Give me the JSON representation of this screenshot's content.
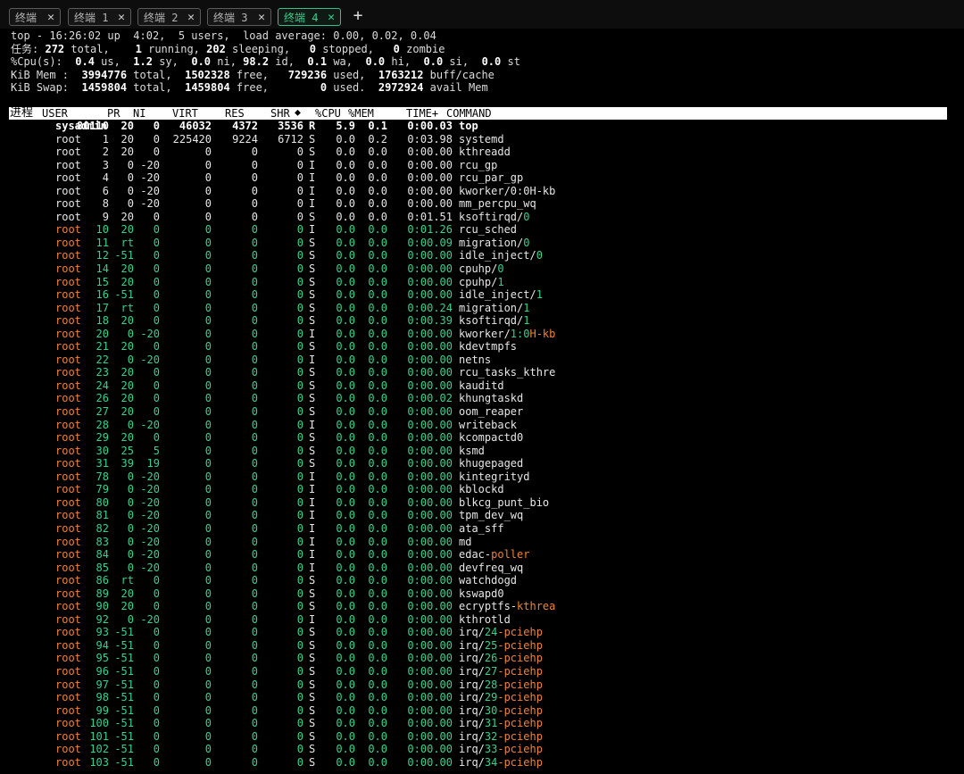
{
  "tabs": [
    {
      "label": "终端",
      "active": false
    },
    {
      "label": "终端 1",
      "active": false
    },
    {
      "label": "终端 2",
      "active": false
    },
    {
      "label": "终端 3",
      "active": false
    },
    {
      "label": "终端 4",
      "active": true
    }
  ],
  "summary": {
    "line1": "top - 16:26:02 up  4:02,  5 users,  load average: 0.00, 0.02, 0.04",
    "tasks": {
      "label": "任务:",
      "total": "272",
      "running": "1",
      "sleeping": "202",
      "stopped": "0",
      "zombie": "0"
    },
    "cpu": {
      "us": "0.4",
      "sy": "1.2",
      "ni": "0.0",
      "id": "98.2",
      "wa": "0.1",
      "hi": "0.0",
      "si": "0.0",
      "st": "0.0"
    },
    "mem": {
      "total": "3994776",
      "free": "1502328",
      "used": "729236",
      "buff": "1763212"
    },
    "swap": {
      "total": "1459804",
      "free": "1459804",
      "used": "0",
      "avail": "2972924"
    }
  },
  "columns": [
    "进程",
    "USER",
    "PR",
    "NI",
    "VIRT",
    "RES",
    "SHR",
    "⬥",
    "%CPU",
    "%MEM",
    "TIME+",
    "COMMAND"
  ],
  "processes": [
    {
      "pid": "80110",
      "user": "sysadmin",
      "pr": "20",
      "ni": "0",
      "virt": "46032",
      "res": "4372",
      "shr": "3536",
      "s": "R",
      "cpu": "5.9",
      "mem": "0.1",
      "time": "0:00.03",
      "cmd": "top",
      "sfx": "",
      "style": "bold"
    },
    {
      "pid": "1",
      "user": "root",
      "pr": "20",
      "ni": "0",
      "virt": "225420",
      "res": "9224",
      "shr": "6712",
      "s": "S",
      "cpu": "0.0",
      "mem": "0.2",
      "time": "0:03.98",
      "cmd": "systemd",
      "sfx": "",
      "style": "w"
    },
    {
      "pid": "2",
      "user": "root",
      "pr": "20",
      "ni": "0",
      "virt": "0",
      "res": "0",
      "shr": "0",
      "s": "S",
      "cpu": "0.0",
      "mem": "0.0",
      "time": "0:00.00",
      "cmd": "kthreadd",
      "sfx": "",
      "style": "w"
    },
    {
      "pid": "3",
      "user": "root",
      "pr": "0",
      "ni": "-20",
      "virt": "0",
      "res": "0",
      "shr": "0",
      "s": "I",
      "cpu": "0.0",
      "mem": "0.0",
      "time": "0:00.00",
      "cmd": "rcu_gp",
      "sfx": "",
      "style": "w"
    },
    {
      "pid": "4",
      "user": "root",
      "pr": "0",
      "ni": "-20",
      "virt": "0",
      "res": "0",
      "shr": "0",
      "s": "I",
      "cpu": "0.0",
      "mem": "0.0",
      "time": "0:00.00",
      "cmd": "rcu_par_gp",
      "sfx": "",
      "style": "w"
    },
    {
      "pid": "6",
      "user": "root",
      "pr": "0",
      "ni": "-20",
      "virt": "0",
      "res": "0",
      "shr": "0",
      "s": "I",
      "cpu": "0.0",
      "mem": "0.0",
      "time": "0:00.00",
      "cmd": "kworker/0:0H-kb",
      "sfx": "",
      "style": "w"
    },
    {
      "pid": "8",
      "user": "root",
      "pr": "0",
      "ni": "-20",
      "virt": "0",
      "res": "0",
      "shr": "0",
      "s": "I",
      "cpu": "0.0",
      "mem": "0.0",
      "time": "0:00.00",
      "cmd": "mm_percpu_wq",
      "sfx": "",
      "style": "w"
    },
    {
      "pid": "9",
      "user": "root",
      "pr": "20",
      "ni": "0",
      "virt": "0",
      "res": "0",
      "shr": "0",
      "s": "S",
      "cpu": "0.0",
      "mem": "0.0",
      "time": "0:01.51",
      "cmd": "ksoftirqd/",
      "sfx": "0",
      "sfxc": "g",
      "style": "w"
    },
    {
      "pid": "10",
      "user": "root",
      "pr": "20",
      "ni": "0",
      "virt": "0",
      "res": "0",
      "shr": "0",
      "s": "I",
      "cpu": "0.0",
      "mem": "0.0",
      "time": "0:01.26",
      "cmd": "rcu_sched",
      "sfx": "",
      "style": "g"
    },
    {
      "pid": "11",
      "user": "root",
      "pr": "rt",
      "ni": "0",
      "virt": "0",
      "res": "0",
      "shr": "0",
      "s": "S",
      "cpu": "0.0",
      "mem": "0.0",
      "time": "0:00.09",
      "cmd": "migration/",
      "sfx": "0",
      "sfxc": "g",
      "style": "g"
    },
    {
      "pid": "12",
      "user": "root",
      "pr": "-51",
      "ni": "0",
      "virt": "0",
      "res": "0",
      "shr": "0",
      "s": "S",
      "cpu": "0.0",
      "mem": "0.0",
      "time": "0:00.00",
      "cmd": "idle_inject/",
      "sfx": "0",
      "sfxc": "g",
      "style": "g"
    },
    {
      "pid": "14",
      "user": "root",
      "pr": "20",
      "ni": "0",
      "virt": "0",
      "res": "0",
      "shr": "0",
      "s": "S",
      "cpu": "0.0",
      "mem": "0.0",
      "time": "0:00.00",
      "cmd": "cpuhp/",
      "sfx": "0",
      "sfxc": "g",
      "style": "g"
    },
    {
      "pid": "15",
      "user": "root",
      "pr": "20",
      "ni": "0",
      "virt": "0",
      "res": "0",
      "shr": "0",
      "s": "S",
      "cpu": "0.0",
      "mem": "0.0",
      "time": "0:00.00",
      "cmd": "cpuhp/",
      "sfx": "1",
      "sfxc": "g",
      "style": "g"
    },
    {
      "pid": "16",
      "user": "root",
      "pr": "-51",
      "ni": "0",
      "virt": "0",
      "res": "0",
      "shr": "0",
      "s": "S",
      "cpu": "0.0",
      "mem": "0.0",
      "time": "0:00.00",
      "cmd": "idle_inject/",
      "sfx": "1",
      "sfxc": "g",
      "style": "g"
    },
    {
      "pid": "17",
      "user": "root",
      "pr": "rt",
      "ni": "0",
      "virt": "0",
      "res": "0",
      "shr": "0",
      "s": "S",
      "cpu": "0.0",
      "mem": "0.0",
      "time": "0:00.24",
      "cmd": "migration/",
      "sfx": "1",
      "sfxc": "g",
      "style": "g"
    },
    {
      "pid": "18",
      "user": "root",
      "pr": "20",
      "ni": "0",
      "virt": "0",
      "res": "0",
      "shr": "0",
      "s": "S",
      "cpu": "0.0",
      "mem": "0.0",
      "time": "0:00.39",
      "cmd": "ksoftirqd/",
      "sfx": "1",
      "sfxc": "g",
      "style": "g"
    },
    {
      "pid": "20",
      "user": "root",
      "pr": "0",
      "ni": "-20",
      "virt": "0",
      "res": "0",
      "shr": "0",
      "s": "I",
      "cpu": "0.0",
      "mem": "0.0",
      "time": "0:00.00",
      "cmd": "kworker/",
      "sfx": "1:0H-kb",
      "sfxc": "mixed",
      "style": "g"
    },
    {
      "pid": "21",
      "user": "root",
      "pr": "20",
      "ni": "0",
      "virt": "0",
      "res": "0",
      "shr": "0",
      "s": "S",
      "cpu": "0.0",
      "mem": "0.0",
      "time": "0:00.00",
      "cmd": "kdevtmpfs",
      "sfx": "",
      "style": "g"
    },
    {
      "pid": "22",
      "user": "root",
      "pr": "0",
      "ni": "-20",
      "virt": "0",
      "res": "0",
      "shr": "0",
      "s": "I",
      "cpu": "0.0",
      "mem": "0.0",
      "time": "0:00.00",
      "cmd": "netns",
      "sfx": "",
      "style": "g"
    },
    {
      "pid": "23",
      "user": "root",
      "pr": "20",
      "ni": "0",
      "virt": "0",
      "res": "0",
      "shr": "0",
      "s": "S",
      "cpu": "0.0",
      "mem": "0.0",
      "time": "0:00.00",
      "cmd": "rcu_tasks_kthre",
      "sfx": "",
      "style": "g"
    },
    {
      "pid": "24",
      "user": "root",
      "pr": "20",
      "ni": "0",
      "virt": "0",
      "res": "0",
      "shr": "0",
      "s": "S",
      "cpu": "0.0",
      "mem": "0.0",
      "time": "0:00.00",
      "cmd": "kauditd",
      "sfx": "",
      "style": "g"
    },
    {
      "pid": "26",
      "user": "root",
      "pr": "20",
      "ni": "0",
      "virt": "0",
      "res": "0",
      "shr": "0",
      "s": "S",
      "cpu": "0.0",
      "mem": "0.0",
      "time": "0:00.02",
      "cmd": "khungtaskd",
      "sfx": "",
      "style": "g"
    },
    {
      "pid": "27",
      "user": "root",
      "pr": "20",
      "ni": "0",
      "virt": "0",
      "res": "0",
      "shr": "0",
      "s": "S",
      "cpu": "0.0",
      "mem": "0.0",
      "time": "0:00.00",
      "cmd": "oom_reaper",
      "sfx": "",
      "style": "g"
    },
    {
      "pid": "28",
      "user": "root",
      "pr": "0",
      "ni": "-20",
      "virt": "0",
      "res": "0",
      "shr": "0",
      "s": "I",
      "cpu": "0.0",
      "mem": "0.0",
      "time": "0:00.00",
      "cmd": "writeback",
      "sfx": "",
      "style": "g"
    },
    {
      "pid": "29",
      "user": "root",
      "pr": "20",
      "ni": "0",
      "virt": "0",
      "res": "0",
      "shr": "0",
      "s": "S",
      "cpu": "0.0",
      "mem": "0.0",
      "time": "0:00.00",
      "cmd": "kcompactd0",
      "sfx": "",
      "style": "g"
    },
    {
      "pid": "30",
      "user": "root",
      "pr": "25",
      "ni": "5",
      "virt": "0",
      "res": "0",
      "shr": "0",
      "s": "S",
      "cpu": "0.0",
      "mem": "0.0",
      "time": "0:00.00",
      "cmd": "ksmd",
      "sfx": "",
      "style": "g"
    },
    {
      "pid": "31",
      "user": "root",
      "pr": "39",
      "ni": "19",
      "virt": "0",
      "res": "0",
      "shr": "0",
      "s": "S",
      "cpu": "0.0",
      "mem": "0.0",
      "time": "0:00.00",
      "cmd": "khugepaged",
      "sfx": "",
      "style": "g"
    },
    {
      "pid": "78",
      "user": "root",
      "pr": "0",
      "ni": "-20",
      "virt": "0",
      "res": "0",
      "shr": "0",
      "s": "I",
      "cpu": "0.0",
      "mem": "0.0",
      "time": "0:00.00",
      "cmd": "kintegrityd",
      "sfx": "",
      "style": "g"
    },
    {
      "pid": "79",
      "user": "root",
      "pr": "0",
      "ni": "-20",
      "virt": "0",
      "res": "0",
      "shr": "0",
      "s": "I",
      "cpu": "0.0",
      "mem": "0.0",
      "time": "0:00.00",
      "cmd": "kblockd",
      "sfx": "",
      "style": "g"
    },
    {
      "pid": "80",
      "user": "root",
      "pr": "0",
      "ni": "-20",
      "virt": "0",
      "res": "0",
      "shr": "0",
      "s": "I",
      "cpu": "0.0",
      "mem": "0.0",
      "time": "0:00.00",
      "cmd": "blkcg_punt_bio",
      "sfx": "",
      "style": "g"
    },
    {
      "pid": "81",
      "user": "root",
      "pr": "0",
      "ni": "-20",
      "virt": "0",
      "res": "0",
      "shr": "0",
      "s": "I",
      "cpu": "0.0",
      "mem": "0.0",
      "time": "0:00.00",
      "cmd": "tpm_dev_wq",
      "sfx": "",
      "style": "g"
    },
    {
      "pid": "82",
      "user": "root",
      "pr": "0",
      "ni": "-20",
      "virt": "0",
      "res": "0",
      "shr": "0",
      "s": "I",
      "cpu": "0.0",
      "mem": "0.0",
      "time": "0:00.00",
      "cmd": "ata_sff",
      "sfx": "",
      "style": "g"
    },
    {
      "pid": "83",
      "user": "root",
      "pr": "0",
      "ni": "-20",
      "virt": "0",
      "res": "0",
      "shr": "0",
      "s": "I",
      "cpu": "0.0",
      "mem": "0.0",
      "time": "0:00.00",
      "cmd": "md",
      "sfx": "",
      "style": "g"
    },
    {
      "pid": "84",
      "user": "root",
      "pr": "0",
      "ni": "-20",
      "virt": "0",
      "res": "0",
      "shr": "0",
      "s": "I",
      "cpu": "0.0",
      "mem": "0.0",
      "time": "0:00.00",
      "cmd": "edac-",
      "sfx": "poller",
      "sfxc": "o",
      "style": "g"
    },
    {
      "pid": "85",
      "user": "root",
      "pr": "0",
      "ni": "-20",
      "virt": "0",
      "res": "0",
      "shr": "0",
      "s": "I",
      "cpu": "0.0",
      "mem": "0.0",
      "time": "0:00.00",
      "cmd": "devfreq_wq",
      "sfx": "",
      "style": "g"
    },
    {
      "pid": "86",
      "user": "root",
      "pr": "rt",
      "ni": "0",
      "virt": "0",
      "res": "0",
      "shr": "0",
      "s": "S",
      "cpu": "0.0",
      "mem": "0.0",
      "time": "0:00.00",
      "cmd": "watchdogd",
      "sfx": "",
      "style": "g"
    },
    {
      "pid": "89",
      "user": "root",
      "pr": "20",
      "ni": "0",
      "virt": "0",
      "res": "0",
      "shr": "0",
      "s": "S",
      "cpu": "0.0",
      "mem": "0.0",
      "time": "0:00.00",
      "cmd": "kswapd0",
      "sfx": "",
      "style": "g"
    },
    {
      "pid": "90",
      "user": "root",
      "pr": "20",
      "ni": "0",
      "virt": "0",
      "res": "0",
      "shr": "0",
      "s": "S",
      "cpu": "0.0",
      "mem": "0.0",
      "time": "0:00.00",
      "cmd": "ecryptfs-",
      "sfx": "kthrea",
      "sfxc": "o",
      "style": "g"
    },
    {
      "pid": "92",
      "user": "root",
      "pr": "0",
      "ni": "-20",
      "virt": "0",
      "res": "0",
      "shr": "0",
      "s": "I",
      "cpu": "0.0",
      "mem": "0.0",
      "time": "0:00.00",
      "cmd": "kthrotld",
      "sfx": "",
      "style": "g"
    },
    {
      "pid": "93",
      "user": "root",
      "pr": "-51",
      "ni": "0",
      "virt": "0",
      "res": "0",
      "shr": "0",
      "s": "S",
      "cpu": "0.0",
      "mem": "0.0",
      "time": "0:00.00",
      "cmd": "irq/",
      "sfx": "24-pciehp",
      "sfxc": "irq",
      "style": "g"
    },
    {
      "pid": "94",
      "user": "root",
      "pr": "-51",
      "ni": "0",
      "virt": "0",
      "res": "0",
      "shr": "0",
      "s": "S",
      "cpu": "0.0",
      "mem": "0.0",
      "time": "0:00.00",
      "cmd": "irq/",
      "sfx": "25-pciehp",
      "sfxc": "irq",
      "style": "g"
    },
    {
      "pid": "95",
      "user": "root",
      "pr": "-51",
      "ni": "0",
      "virt": "0",
      "res": "0",
      "shr": "0",
      "s": "S",
      "cpu": "0.0",
      "mem": "0.0",
      "time": "0:00.00",
      "cmd": "irq/",
      "sfx": "26-pciehp",
      "sfxc": "irq",
      "style": "g"
    },
    {
      "pid": "96",
      "user": "root",
      "pr": "-51",
      "ni": "0",
      "virt": "0",
      "res": "0",
      "shr": "0",
      "s": "S",
      "cpu": "0.0",
      "mem": "0.0",
      "time": "0:00.00",
      "cmd": "irq/",
      "sfx": "27-pciehp",
      "sfxc": "irq",
      "style": "g"
    },
    {
      "pid": "97",
      "user": "root",
      "pr": "-51",
      "ni": "0",
      "virt": "0",
      "res": "0",
      "shr": "0",
      "s": "S",
      "cpu": "0.0",
      "mem": "0.0",
      "time": "0:00.00",
      "cmd": "irq/",
      "sfx": "28-pciehp",
      "sfxc": "irq",
      "style": "g"
    },
    {
      "pid": "98",
      "user": "root",
      "pr": "-51",
      "ni": "0",
      "virt": "0",
      "res": "0",
      "shr": "0",
      "s": "S",
      "cpu": "0.0",
      "mem": "0.0",
      "time": "0:00.00",
      "cmd": "irq/",
      "sfx": "29-pciehp",
      "sfxc": "irq",
      "style": "g"
    },
    {
      "pid": "99",
      "user": "root",
      "pr": "-51",
      "ni": "0",
      "virt": "0",
      "res": "0",
      "shr": "0",
      "s": "S",
      "cpu": "0.0",
      "mem": "0.0",
      "time": "0:00.00",
      "cmd": "irq/",
      "sfx": "30-pciehp",
      "sfxc": "irq",
      "style": "g"
    },
    {
      "pid": "100",
      "user": "root",
      "pr": "-51",
      "ni": "0",
      "virt": "0",
      "res": "0",
      "shr": "0",
      "s": "S",
      "cpu": "0.0",
      "mem": "0.0",
      "time": "0:00.00",
      "cmd": "irq/",
      "sfx": "31-pciehp",
      "sfxc": "irq",
      "style": "g"
    },
    {
      "pid": "101",
      "user": "root",
      "pr": "-51",
      "ni": "0",
      "virt": "0",
      "res": "0",
      "shr": "0",
      "s": "S",
      "cpu": "0.0",
      "mem": "0.0",
      "time": "0:00.00",
      "cmd": "irq/",
      "sfx": "32-pciehp",
      "sfxc": "irq",
      "style": "g"
    },
    {
      "pid": "102",
      "user": "root",
      "pr": "-51",
      "ni": "0",
      "virt": "0",
      "res": "0",
      "shr": "0",
      "s": "S",
      "cpu": "0.0",
      "mem": "0.0",
      "time": "0:00.00",
      "cmd": "irq/",
      "sfx": "33-pciehp",
      "sfxc": "irq",
      "style": "g"
    },
    {
      "pid": "103",
      "user": "root",
      "pr": "-51",
      "ni": "0",
      "virt": "0",
      "res": "0",
      "shr": "0",
      "s": "S",
      "cpu": "0.0",
      "mem": "0.0",
      "time": "0:00.00",
      "cmd": "irq/",
      "sfx": "34-pciehp",
      "sfxc": "irq",
      "style": "g"
    }
  ],
  "colors": {
    "green": "#2fd48e",
    "orange": "#f0822f",
    "white": "#e6e6e6",
    "tab_active": "#35d18f"
  },
  "icons": {
    "close": "close-icon",
    "new_tab": "plus-icon",
    "sort": "sort-icon"
  }
}
